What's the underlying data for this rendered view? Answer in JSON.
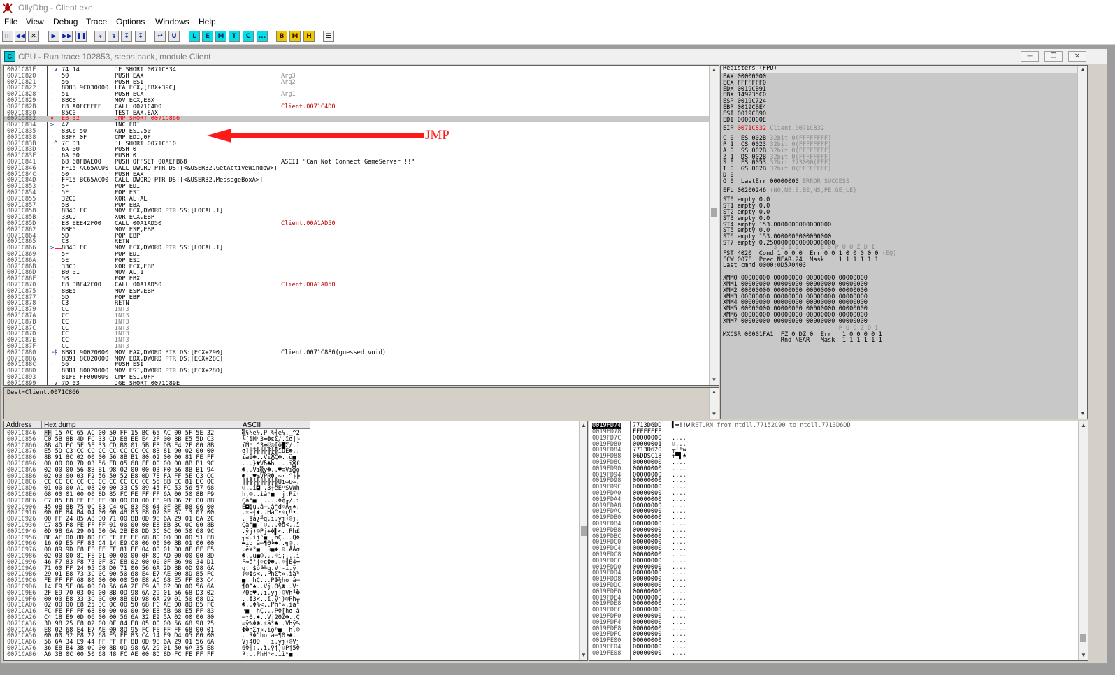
{
  "app_title": "OllyDbg - Client.exe",
  "menu": [
    "File",
    "View",
    "Debug",
    "Trace",
    "Options",
    "Windows",
    "Help"
  ],
  "toolbar": {
    "letters": [
      "L",
      "E",
      "M",
      "T",
      "C",
      "...",
      "B",
      "M",
      "H"
    ]
  },
  "cpu_window": {
    "title": "CPU - Run trace 102853, steps back, module Client",
    "icon_letter": "C"
  },
  "annotation": {
    "label": "JMP"
  },
  "disasm": [
    {
      "addr": "0071C81E",
      "mark": "·∨",
      "hex": "74 14",
      "cmd": "JE SHORT 0071C834",
      "cmt": "",
      "style": ""
    },
    {
      "addr": "0071C820",
      "mark": "·",
      "hex": "50",
      "cmd": "PUSH EAX",
      "cmt": "Arg3",
      "style": "gray"
    },
    {
      "addr": "0071C821",
      "mark": "·",
      "hex": "56",
      "cmd": "PUSH ESI",
      "cmt": "Arg2",
      "style": "gray"
    },
    {
      "addr": "0071C822",
      "mark": "·",
      "hex": "8D8B 9C030000",
      "cmd": "LEA ECX,[EBX+39C]",
      "cmt": "",
      "style": ""
    },
    {
      "addr": "0071C828",
      "mark": "·",
      "hex": "51",
      "cmd": "PUSH ECX",
      "cmt": "Arg1",
      "style": "gray"
    },
    {
      "addr": "0071C829",
      "mark": "·",
      "hex": "8BCB",
      "cmd": "MOV ECX,EBX",
      "cmt": "",
      "style": ""
    },
    {
      "addr": "0071C82B",
      "mark": "·",
      "hex": "E8 A0FCFFFF",
      "cmd": "CALL 0071C4D0",
      "cmt": "Client.0071C4D0",
      "style": "red"
    },
    {
      "addr": "0071C830",
      "mark": "·",
      "hex": "85C0",
      "cmd": "TEST EAX,EAX",
      "cmt": "",
      "style": ""
    },
    {
      "addr": "0071C832",
      "mark": "∨",
      "hex": "EB 32",
      "cmd": "JMP SHORT 0071C866",
      "cmt": "",
      "style": "sel"
    },
    {
      "addr": "0071C834",
      "mark": ">",
      "hex": "47",
      "cmd": "INC EDI",
      "cmt": "",
      "style": ""
    },
    {
      "addr": "0071C835",
      "mark": "·",
      "hex": "83C6 50",
      "cmd": "ADD ESI,50",
      "cmt": "",
      "style": ""
    },
    {
      "addr": "0071C838",
      "mark": "·",
      "hex": "83FF 0F",
      "cmd": "CMP EDI,0F",
      "cmt": "",
      "style": ""
    },
    {
      "addr": "0071C83B",
      "mark": "·^",
      "hex": "7C D3",
      "cmd": "JL SHORT 0071C810",
      "cmt": "",
      "style": ""
    },
    {
      "addr": "0071C83D",
      "mark": "·",
      "hex": "6A 00",
      "cmd": "PUSH 0",
      "cmt": "",
      "style": ""
    },
    {
      "addr": "0071C83F",
      "mark": "·",
      "hex": "6A 00",
      "cmd": "PUSH 0",
      "cmt": "",
      "style": ""
    },
    {
      "addr": "0071C841",
      "mark": "·",
      "hex": "68 68FBAE00",
      "cmd": "PUSH OFFSET 00AEFB68",
      "cmt": "ASCII \"Can Not Connect GameServer !!\"",
      "style": ""
    },
    {
      "addr": "0071C846",
      "mark": "·",
      "hex": "FF15 AC65AC00",
      "cmd": "CALL DWORD PTR DS:[<&USER32.GetActiveWindow>]",
      "cmt": "",
      "style": ""
    },
    {
      "addr": "0071C84C",
      "mark": "·",
      "hex": "50",
      "cmd": "PUSH EAX",
      "cmt": "",
      "style": ""
    },
    {
      "addr": "0071C84D",
      "mark": "·",
      "hex": "FF15 BC65AC00",
      "cmd": "CALL DWORD PTR DS:[<&USER32.MessageBoxA>]",
      "cmt": "",
      "style": ""
    },
    {
      "addr": "0071C853",
      "mark": "·",
      "hex": "5F",
      "cmd": "POP EDI",
      "cmt": "",
      "style": ""
    },
    {
      "addr": "0071C854",
      "mark": "·",
      "hex": "5E",
      "cmd": "POP ESI",
      "cmt": "",
      "style": ""
    },
    {
      "addr": "0071C855",
      "mark": "·",
      "hex": "32C0",
      "cmd": "XOR AL,AL",
      "cmt": "",
      "style": ""
    },
    {
      "addr": "0071C857",
      "mark": "·",
      "hex": "5B",
      "cmd": "POP EBX",
      "cmt": "",
      "style": ""
    },
    {
      "addr": "0071C858",
      "mark": "·",
      "hex": "8B4D FC",
      "cmd": "MOV ECX,DWORD PTR SS:[LOCAL.1]",
      "cmt": "",
      "style": ""
    },
    {
      "addr": "0071C85B",
      "mark": "·",
      "hex": "33CD",
      "cmd": "XOR ECX,EBP",
      "cmt": "",
      "style": ""
    },
    {
      "addr": "0071C85D",
      "mark": "·",
      "hex": "E8 EEE42F00",
      "cmd": "CALL 00A1AD50",
      "cmt": "Client.00A1AD50",
      "style": "red"
    },
    {
      "addr": "0071C862",
      "mark": "·",
      "hex": "8BE5",
      "cmd": "MOV ESP,EBP",
      "cmt": "",
      "style": ""
    },
    {
      "addr": "0071C864",
      "mark": "·",
      "hex": "5D",
      "cmd": "POP EBP",
      "cmt": "",
      "style": ""
    },
    {
      "addr": "0071C865",
      "mark": "·",
      "hex": "C3",
      "cmd": "RETN",
      "cmt": "",
      "style": ""
    },
    {
      "addr": "0071C866",
      "mark": ">",
      "hex": "8B4D FC",
      "cmd": "MOV ECX,DWORD PTR SS:[LOCAL.1]",
      "cmt": "",
      "style": ""
    },
    {
      "addr": "0071C869",
      "mark": "·",
      "hex": "5F",
      "cmd": "POP EDI",
      "cmt": "",
      "style": ""
    },
    {
      "addr": "0071C86A",
      "mark": "·",
      "hex": "5E",
      "cmd": "POP ESI",
      "cmt": "",
      "style": ""
    },
    {
      "addr": "0071C86B",
      "mark": "·",
      "hex": "33CD",
      "cmd": "XOR ECX,EBP",
      "cmt": "",
      "style": ""
    },
    {
      "addr": "0071C86D",
      "mark": "·",
      "hex": "B0 01",
      "cmd": "MOV AL,1",
      "cmt": "",
      "style": ""
    },
    {
      "addr": "0071C86F",
      "mark": "·",
      "hex": "5B",
      "cmd": "POP EBX",
      "cmt": "",
      "style": ""
    },
    {
      "addr": "0071C870",
      "mark": "·",
      "hex": "E8 DBE42F00",
      "cmd": "CALL 00A1AD50",
      "cmt": "Client.00A1AD50",
      "style": "red"
    },
    {
      "addr": "0071C875",
      "mark": "·",
      "hex": "8BE5",
      "cmd": "MOV ESP,EBP",
      "cmt": "",
      "style": ""
    },
    {
      "addr": "0071C877",
      "mark": "·",
      "hex": "5D",
      "cmd": "POP EBP",
      "cmt": "",
      "style": ""
    },
    {
      "addr": "0071C878",
      "mark": "·",
      "hex": "C3",
      "cmd": "RETN",
      "cmt": "",
      "style": ""
    },
    {
      "addr": "0071C879",
      "mark": "",
      "hex": "CC",
      "cmd": "INT3",
      "cmt": "",
      "style": "int3"
    },
    {
      "addr": "0071C87A",
      "mark": "",
      "hex": "CC",
      "cmd": "INT3",
      "cmt": "",
      "style": "int3"
    },
    {
      "addr": "0071C87B",
      "mark": "",
      "hex": "CC",
      "cmd": "INT3",
      "cmt": "",
      "style": "int3"
    },
    {
      "addr": "0071C87C",
      "mark": "",
      "hex": "CC",
      "cmd": "INT3",
      "cmt": "",
      "style": "int3"
    },
    {
      "addr": "0071C87D",
      "mark": "",
      "hex": "CC",
      "cmd": "INT3",
      "cmt": "",
      "style": "int3"
    },
    {
      "addr": "0071C87E",
      "mark": "",
      "hex": "CC",
      "cmd": "INT3",
      "cmt": "",
      "style": "int3"
    },
    {
      "addr": "0071C87F",
      "mark": "",
      "hex": "CC",
      "cmd": "INT3",
      "cmt": "",
      "style": "int3"
    },
    {
      "addr": "0071C880",
      "mark": "┌$",
      "hex": "8B81 90020000",
      "cmd": "MOV EAX,DWORD PTR DS:[ECX+290]",
      "cmt": "Client.0071C880(guessed void)",
      "style": ""
    },
    {
      "addr": "0071C886",
      "mark": "·",
      "hex": "8B91 8C020000",
      "cmd": "MOV EDX,DWORD PTR DS:[ECX+28C]",
      "cmt": "",
      "style": ""
    },
    {
      "addr": "0071C88C",
      "mark": "·",
      "hex": "56",
      "cmd": "PUSH ESI",
      "cmt": "",
      "style": ""
    },
    {
      "addr": "0071C88D",
      "mark": "·",
      "hex": "8BB1 80020000",
      "cmd": "MOV ESI,DWORD PTR DS:[ECX+280]",
      "cmt": "",
      "style": ""
    },
    {
      "addr": "0071C893",
      "mark": "·",
      "hex": "81FE FF000000",
      "cmd": "CMP ESI,0FF",
      "cmt": "",
      "style": ""
    },
    {
      "addr": "0071C899",
      "mark": "·∨",
      "hex": "7D 03",
      "cmd": "JGE SHORT 0071C89E",
      "cmt": "",
      "style": ""
    }
  ],
  "info_line": "Dest=Client.0071C866",
  "registers": {
    "header": "Registers (FPU)",
    "gp": [
      {
        "name": "EAX",
        "value": "00000000",
        "note": ""
      },
      {
        "name": "ECX",
        "value": "FFFFFFF0",
        "note": ""
      },
      {
        "name": "EDX",
        "value": "0019CB91",
        "note": ""
      },
      {
        "name": "EBX",
        "value": "149235C0",
        "note": ""
      },
      {
        "name": "ESP",
        "value": "0019C724",
        "note": ""
      },
      {
        "name": "EBP",
        "value": "0019CBE4",
        "note": ""
      },
      {
        "name": "ESI",
        "value": "0019CB90",
        "note": ""
      },
      {
        "name": "EDI",
        "value": "0000000E",
        "note": ""
      }
    ],
    "eip": {
      "name": "EIP",
      "value": "0071C832",
      "note": "Client.0071C832"
    },
    "flags": [
      {
        "f": "C 0",
        "seg": "ES 002B",
        "note": "32bit 0(FFFFFFFF)"
      },
      {
        "f": "P 1",
        "seg": "CS 0023",
        "note": "32bit 0(FFFFFFFF)"
      },
      {
        "f": "A 0",
        "seg": "SS 002B",
        "note": "32bit 0(FFFFFFFF)"
      },
      {
        "f": "Z 1",
        "seg": "DS 002B",
        "note": "32bit 0(FFFFFFFF)"
      },
      {
        "f": "S 0",
        "seg": "FS 0053",
        "note": "32bit 273000(FFF)"
      },
      {
        "f": "T 0",
        "seg": "GS 002B",
        "note": "32bit 0(FFFFFFFF)"
      },
      {
        "f": "D 0",
        "seg": "",
        "note": ""
      },
      {
        "f": "O 0",
        "seg": "LastErr 00000000",
        "note": "ERROR_SUCCESS"
      }
    ],
    "efl": {
      "text": "EFL 00200246",
      "note": "(NO,NB,E,BE,NS,PE,GE,LE)"
    },
    "fpu": [
      "ST0 empty 0.0",
      "ST1 empty 0.0",
      "ST2 empty 0.0",
      "ST3 empty 0.0",
      "ST4 empty 153.0000000000000000",
      "ST5 empty 0.0",
      "ST6 empty 153.0000000000000000",
      "ST7 empty 0.2500000000000000000"
    ],
    "fpu_hdr": "              3 2 1 0      E S P U O Z D I",
    "fst": {
      "text": "FST 4020  Cond 1 0 0 0  Err 0 0 1 0 0 0 0 0",
      "note": "(EQ)"
    },
    "fcw": "FCW 007F  Prec NEAR,24  Mask    1 1 1 1 1 1",
    "last_cmnd": "Last cmnd 0000:0D5A0403",
    "xmm": [
      "XMM0 00000000 00000000 00000000 00000000",
      "XMM1 00000000 00000000 00000000 00000000",
      "XMM2 00000000 00000000 00000000 00000000",
      "XMM3 00000000 00000000 00000000 00000000",
      "XMM4 00000000 00000000 00000000 00000000",
      "XMM5 00000000 00000000 00000000 00000000",
      "XMM6 00000000 00000000 00000000 00000000",
      "XMM7 00000000 00000000 00000000 00000000"
    ],
    "mx_hdr": "                                P U O Z D I",
    "mxcsr": "MXCSR 00001FA1  FZ 0 DZ 0  Err   1 0 0 0 0 1",
    "mxcsr2": "                Rnd NEAR   Mask  1 1 1 1 1 1"
  },
  "dump": {
    "headers": [
      "Address",
      "Hex dump",
      "ASCII"
    ],
    "rows": [
      [
        "0071C846",
        "FF 15 AC 65 AC 00 50 FF 15 BC 65 AC 00 5F 5E 32",
        "▒§½e¼.P §╡e¼._^2"
      ],
      [
        "0071C856",
        "C0 5B 8B 4D FC 33 CD E8 EE E4 2F 00 8B E5 5D C3",
        "└[ïMⁿ3═ΦεΣ/.ïσ]├"
      ],
      [
        "0071C866",
        "8B 4D FC 5F 5E 33 CD B0 01 5B E8 DB E4 2F 00 8B",
        "ïMⁿ_^3═░☺[Φ█Σ/.ï"
      ],
      [
        "0071C876",
        "E5 5D C3 CC CC CC CC CC CC CC 8B 81 90 02 00 00",
        "σ]├╠╠╠╠╠╠╠ïüÉ☻.."
      ],
      [
        "0071C886",
        "8B 91 8C 02 00 00 56 8B B1 80 02 00 00 81 FE FF",
        "ïæî☻..Vï▒Ç☻..ü■ "
      ],
      [
        "0071C896",
        "00 00 00 7D 03 56 EB 05 68 FF 00 00 00 8B B1 9C",
        "...}♥Vδ♣h ...ï▒£"
      ],
      [
        "0071C8A6",
        "02 00 00 56 8B B1 98 02 00 00 03 F0 56 8B B1 94",
        "☻..Vï▒ÿ☻..♥≡Vï▒ö"
      ],
      [
        "0071C8B6",
        "02 00 00 03 F2 56 50 52 E8 0D 7E FA FF 5E C3 CC",
        "☻..♥≥VPRΦ.~· ^├╠"
      ],
      [
        "0071C8C6",
        "CC CC CC CC CC CC CC CC CC CC 55 8B EC 81 EC 0C",
        "╠╠╠╠╠╠╠╠╠╠Uï∞ü∞."
      ],
      [
        "0071C8D6",
        "01 00 00 A1 08 20 00 33 C5 89 45 FC 53 56 57 68",
        "☺..í◘ .3┼ëEⁿSVWh"
      ],
      [
        "0071C8E6",
        "68 00 01 00 00 8D 85 FC FE FF FF 6A 00 50 8B F9",
        "h.☺..ìàⁿ■  j.Pï·"
      ],
      [
        "0071C8F6",
        "C7 85 F8 FE FF FF 00 00 00 00 E8 9B D6 2F 00 8B",
        "Çà°■  ....Φ¢╓/.ï"
      ],
      [
        "0071C906",
        "45 08 8B 75 0C 83 C4 0C 83 F8 64 0F 8F B8 06 00",
        "E◘ïu.â─.â°d☼Å╕♠."
      ],
      [
        "0071C916",
        "00 0F 84 B4 04 00 00 48 83 F8 07 0F 87 13 07 00",
        ".☼ä┤♦..Hâ°•☼ç‼•."
      ],
      [
        "0071C926",
        "00 FF 24 85 A8 D0 71 00 8B 0D 98 6A 29 01 6A 2C",
        ". $à¿╨q.ï.ÿj)☺j,"
      ],
      [
        "0071C936",
        "C7 85 F8 FE FF FF 01 00 00 00 E8 EB 3C 0C 00 8B",
        "Çà°■  ☺...Φδ<..ï"
      ],
      [
        "0071C946",
        "0D 98 6A 29 01 50 6A 2B E8 DD 3C 0C 00 50 68 9C",
        ".ÿj)☺Pj+Φ▌<..Ph£"
      ],
      [
        "0071C956",
        "BF AE 00 8D 8D FC FE FF FF 68 80 00 00 00 51 E8",
        "┐«.ììⁿ■  hÇ...QΦ"
      ],
      [
        "0071C966",
        "16 69 E5 FF 83 C4 14 E9 C8 06 00 00 BB 01 00 00",
        "▬iσ â─¶Θ╚♠..╗☺.."
      ],
      [
        "0071C976",
        "00 89 9D F8 FE FF FF 81 FE 04 00 01 00 8F 8F E5",
        ".ë¥°■  ü■♦.☺.ÅÅσ"
      ],
      [
        "0071C986",
        "02 00 00 81 FE 01 00 00 00 0F 8D AD 00 00 00 8D",
        "☻..ü■☺...☼ì¡...ì"
      ],
      [
        "0071C996",
        "46 F7 83 F8 7B 0F 87 E8 02 00 00 0F B6 90 34 D1",
        "F≈â°{☼çΦ☻..☼╢É4╤"
      ],
      [
        "0071C9A6",
        "71 00 FF 24 95 C8 D0 71 00 56 6A 2D 8B 0D 98 6A",
        "q. $ò╚╨q.Vj-ï.ÿj"
      ],
      [
        "0071C9B6",
        "29 01 E8 73 3C 0C 00 50 68 E4 E7 AE 00 8D 85 FC",
        ")☺Φs<..PhΣτ«.ìàⁿ"
      ],
      [
        "0071C9C6",
        "FE FF FF 68 80 00 00 00 50 E8 AC 68 E5 FF 83 C4",
        "■  hÇ...PΦ¼hσ â─"
      ],
      [
        "0071C9D6",
        "14 E9 5E 06 00 00 56 6A 2E E9 AB 02 00 00 56 6A",
        "¶Θ^♠..Vj.Θ½☻..Vj"
      ],
      [
        "0071C9E6",
        "2F E9 70 03 00 00 8B 0D 98 6A 29 01 56 68 D3 02",
        "/Θp♥..ï.ÿj)☺Vh╙☻"
      ],
      [
        "0071C9F6",
        "00 00 E8 33 3C 0C 00 8B 0D 98 6A 29 01 50 68 D2",
        "..Φ3<..ï.ÿj)☺Ph╥"
      ],
      [
        "0071CA06",
        "02 00 00 E8 25 3C 0C 00 50 68 FC AE 00 8D 85 FC",
        "☻..Φ%<..Phⁿ«.ìàⁿ"
      ],
      [
        "0071CA16",
        "FC FE FF FF 68 80 00 00 00 50 E8 5B 68 E5 FF 83",
        "ⁿ■  hÇ...PΦ[hσ â"
      ],
      [
        "0071CA26",
        "C4 18 E9 0D 06 00 00 56 6A 32 E9 5A 02 00 00 80",
        "─↑Θ.♠..Vj2ΘZ☻..Ç"
      ],
      [
        "0071CA36",
        "3D 98 25 E8 02 00 0F 84 F8 05 00 00 56 68 98 25",
        "=ÿ%Φ☻.☼ä°♣..Vhÿ%"
      ],
      [
        "0071CA46",
        "E8 02 68 E4 E7 AE 00 8D 95 FC FE FF FF 68 00 01",
        "Φ☻hΣτ«.ìòⁿ■  h.☺"
      ],
      [
        "0071CA56",
        "00 00 52 E8 22 68 E5 FF 83 C4 14 E9 D4 05 00 00",
        "..RΦ\"hσ â─¶Θ╘♣.."
      ],
      [
        "0071CA66",
        "56 6A 34 E9 44 FF FF FF 8B 0D 98 6A 29 01 56 6A",
        "Vj4ΘD   ï.ÿj)☺Vj"
      ],
      [
        "0071CA76",
        "36 E8 B4 3B 0C 00 8B 0D 98 6A 29 01 50 6A 35 E8",
        "6Φ┤;..ï.ÿj)☺Pj5Φ"
      ],
      [
        "0071CA86",
        "A6 3B 0C 00 50 68 48 FC AE 00 8D 8D FC FE FF FF",
        "ª;..PhHⁿ«.ììⁿ■  "
      ]
    ]
  },
  "stack": {
    "header_addr": "0019FD74",
    "header_val": "7713D6DD",
    "header_asc": "▌╤!!w",
    "header_cmt": "RETURN from ntdll.77152C90 to ntdll.7713D6DD",
    "rows": [
      [
        "0019FD78",
        "FFFFFFFF",
        "    "
      ],
      [
        "0019FD7C",
        "00000000",
        "...."
      ],
      [
        "0019FD80",
        "00000001",
        "☺..."
      ],
      [
        "0019FD84",
        "7713D620",
        "╤!!w"
      ],
      [
        "0019FD88",
        "06DDSC18",
        "↑▀▌♠"
      ],
      [
        "0019FD8C",
        "00000000",
        "...."
      ],
      [
        "0019FD90",
        "00000000",
        "...."
      ],
      [
        "0019FD94",
        "00000000",
        "...."
      ],
      [
        "0019FD98",
        "00000000",
        "...."
      ],
      [
        "0019FD9C",
        "00000000",
        "...."
      ],
      [
        "0019FDA0",
        "00000000",
        "...."
      ],
      [
        "0019FDA4",
        "00000000",
        "...."
      ],
      [
        "0019FDA8",
        "00000000",
        "...."
      ],
      [
        "0019FDAC",
        "00000000",
        "...."
      ],
      [
        "0019FDB0",
        "00000000",
        "...."
      ],
      [
        "0019FDB4",
        "00000000",
        "...."
      ],
      [
        "0019FDB8",
        "00000000",
        "...."
      ],
      [
        "0019FDBC",
        "00000000",
        "...."
      ],
      [
        "0019FDC0",
        "00000000",
        "...."
      ],
      [
        "0019FDC4",
        "00000000",
        "...."
      ],
      [
        "0019FDC8",
        "00000000",
        "...."
      ],
      [
        "0019FDCC",
        "00000000",
        "...."
      ],
      [
        "0019FDD0",
        "00000000",
        "...."
      ],
      [
        "0019FDD4",
        "00000000",
        "...."
      ],
      [
        "0019FDD8",
        "00000000",
        "...."
      ],
      [
        "0019FDDC",
        "00000000",
        "...."
      ],
      [
        "0019FDE0",
        "00000000",
        "...."
      ],
      [
        "0019FDE4",
        "00000000",
        "...."
      ],
      [
        "0019FDE8",
        "00000000",
        "...."
      ],
      [
        "0019FDEC",
        "00000000",
        "...."
      ],
      [
        "0019FDF0",
        "00000000",
        "...."
      ],
      [
        "0019FDF4",
        "00000000",
        "...."
      ],
      [
        "0019FDF8",
        "00000000",
        "...."
      ],
      [
        "0019FDFC",
        "00000000",
        "...."
      ],
      [
        "0019FE00",
        "00000000",
        "...."
      ],
      [
        "0019FE04",
        "00000000",
        "...."
      ],
      [
        "0019FE08",
        "00000000",
        "...."
      ]
    ]
  },
  "colors": {
    "accent_red": "#ff1a1a",
    "selection": "#c8c8c8",
    "panel": "#d4d0c8"
  }
}
